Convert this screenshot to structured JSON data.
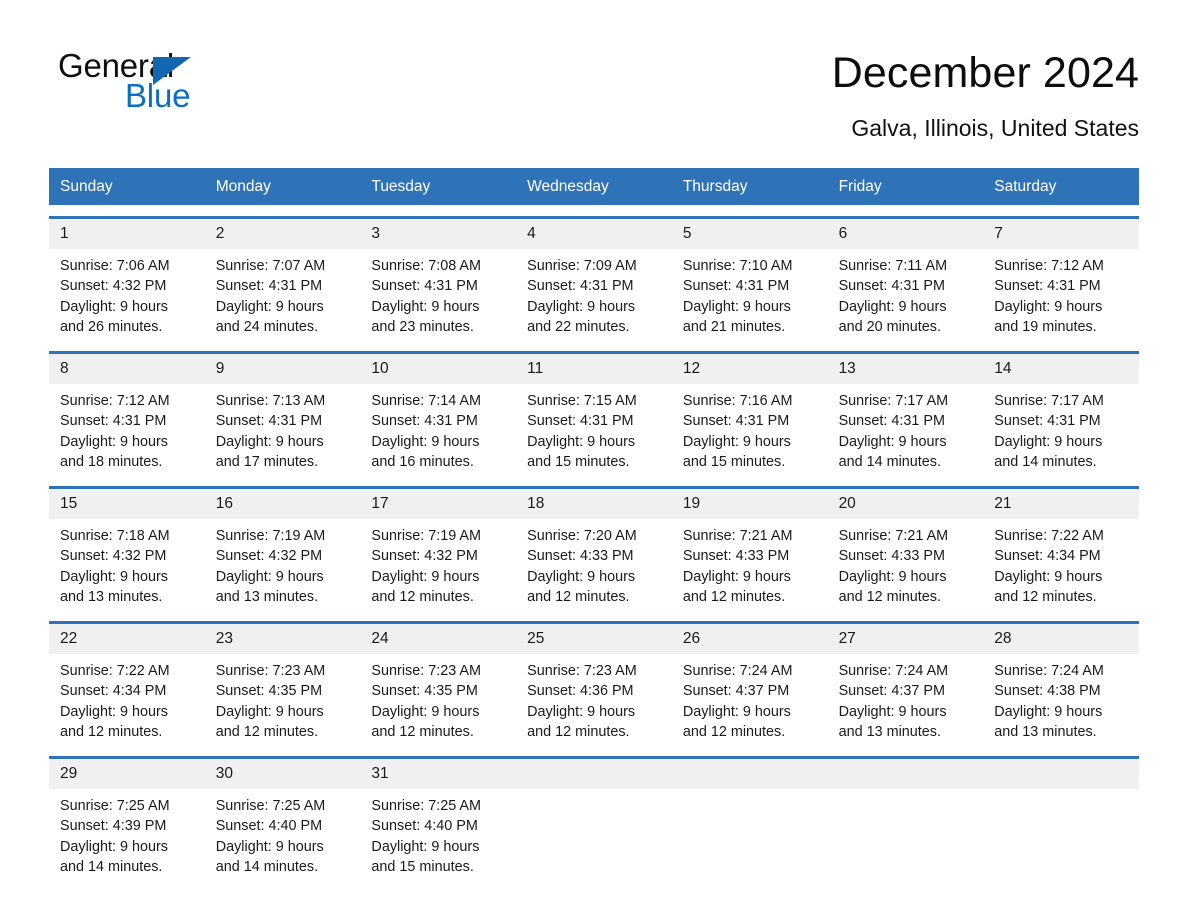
{
  "brand": {
    "word1": "General",
    "word2": "Blue",
    "triangle_color": "#1267b0",
    "blue_color": "#0a6fc2"
  },
  "header": {
    "title": "December 2024",
    "location": "Galva, Illinois, United States"
  },
  "theme": {
    "header_blue": "#2e73b8",
    "date_band": "#f0f0f0",
    "text": "#1a1a1a"
  },
  "weekdays": [
    "Sunday",
    "Monday",
    "Tuesday",
    "Wednesday",
    "Thursday",
    "Friday",
    "Saturday"
  ],
  "weeks": [
    [
      {
        "date": "1",
        "sunrise": "Sunrise: 7:06 AM",
        "sunset": "Sunset: 4:32 PM",
        "daylight1": "Daylight: 9 hours",
        "daylight2": "and 26 minutes."
      },
      {
        "date": "2",
        "sunrise": "Sunrise: 7:07 AM",
        "sunset": "Sunset: 4:31 PM",
        "daylight1": "Daylight: 9 hours",
        "daylight2": "and 24 minutes."
      },
      {
        "date": "3",
        "sunrise": "Sunrise: 7:08 AM",
        "sunset": "Sunset: 4:31 PM",
        "daylight1": "Daylight: 9 hours",
        "daylight2": "and 23 minutes."
      },
      {
        "date": "4",
        "sunrise": "Sunrise: 7:09 AM",
        "sunset": "Sunset: 4:31 PM",
        "daylight1": "Daylight: 9 hours",
        "daylight2": "and 22 minutes."
      },
      {
        "date": "5",
        "sunrise": "Sunrise: 7:10 AM",
        "sunset": "Sunset: 4:31 PM",
        "daylight1": "Daylight: 9 hours",
        "daylight2": "and 21 minutes."
      },
      {
        "date": "6",
        "sunrise": "Sunrise: 7:11 AM",
        "sunset": "Sunset: 4:31 PM",
        "daylight1": "Daylight: 9 hours",
        "daylight2": "and 20 minutes."
      },
      {
        "date": "7",
        "sunrise": "Sunrise: 7:12 AM",
        "sunset": "Sunset: 4:31 PM",
        "daylight1": "Daylight: 9 hours",
        "daylight2": "and 19 minutes."
      }
    ],
    [
      {
        "date": "8",
        "sunrise": "Sunrise: 7:12 AM",
        "sunset": "Sunset: 4:31 PM",
        "daylight1": "Daylight: 9 hours",
        "daylight2": "and 18 minutes."
      },
      {
        "date": "9",
        "sunrise": "Sunrise: 7:13 AM",
        "sunset": "Sunset: 4:31 PM",
        "daylight1": "Daylight: 9 hours",
        "daylight2": "and 17 minutes."
      },
      {
        "date": "10",
        "sunrise": "Sunrise: 7:14 AM",
        "sunset": "Sunset: 4:31 PM",
        "daylight1": "Daylight: 9 hours",
        "daylight2": "and 16 minutes."
      },
      {
        "date": "11",
        "sunrise": "Sunrise: 7:15 AM",
        "sunset": "Sunset: 4:31 PM",
        "daylight1": "Daylight: 9 hours",
        "daylight2": "and 15 minutes."
      },
      {
        "date": "12",
        "sunrise": "Sunrise: 7:16 AM",
        "sunset": "Sunset: 4:31 PM",
        "daylight1": "Daylight: 9 hours",
        "daylight2": "and 15 minutes."
      },
      {
        "date": "13",
        "sunrise": "Sunrise: 7:17 AM",
        "sunset": "Sunset: 4:31 PM",
        "daylight1": "Daylight: 9 hours",
        "daylight2": "and 14 minutes."
      },
      {
        "date": "14",
        "sunrise": "Sunrise: 7:17 AM",
        "sunset": "Sunset: 4:31 PM",
        "daylight1": "Daylight: 9 hours",
        "daylight2": "and 14 minutes."
      }
    ],
    [
      {
        "date": "15",
        "sunrise": "Sunrise: 7:18 AM",
        "sunset": "Sunset: 4:32 PM",
        "daylight1": "Daylight: 9 hours",
        "daylight2": "and 13 minutes."
      },
      {
        "date": "16",
        "sunrise": "Sunrise: 7:19 AM",
        "sunset": "Sunset: 4:32 PM",
        "daylight1": "Daylight: 9 hours",
        "daylight2": "and 13 minutes."
      },
      {
        "date": "17",
        "sunrise": "Sunrise: 7:19 AM",
        "sunset": "Sunset: 4:32 PM",
        "daylight1": "Daylight: 9 hours",
        "daylight2": "and 12 minutes."
      },
      {
        "date": "18",
        "sunrise": "Sunrise: 7:20 AM",
        "sunset": "Sunset: 4:33 PM",
        "daylight1": "Daylight: 9 hours",
        "daylight2": "and 12 minutes."
      },
      {
        "date": "19",
        "sunrise": "Sunrise: 7:21 AM",
        "sunset": "Sunset: 4:33 PM",
        "daylight1": "Daylight: 9 hours",
        "daylight2": "and 12 minutes."
      },
      {
        "date": "20",
        "sunrise": "Sunrise: 7:21 AM",
        "sunset": "Sunset: 4:33 PM",
        "daylight1": "Daylight: 9 hours",
        "daylight2": "and 12 minutes."
      },
      {
        "date": "21",
        "sunrise": "Sunrise: 7:22 AM",
        "sunset": "Sunset: 4:34 PM",
        "daylight1": "Daylight: 9 hours",
        "daylight2": "and 12 minutes."
      }
    ],
    [
      {
        "date": "22",
        "sunrise": "Sunrise: 7:22 AM",
        "sunset": "Sunset: 4:34 PM",
        "daylight1": "Daylight: 9 hours",
        "daylight2": "and 12 minutes."
      },
      {
        "date": "23",
        "sunrise": "Sunrise: 7:23 AM",
        "sunset": "Sunset: 4:35 PM",
        "daylight1": "Daylight: 9 hours",
        "daylight2": "and 12 minutes."
      },
      {
        "date": "24",
        "sunrise": "Sunrise: 7:23 AM",
        "sunset": "Sunset: 4:35 PM",
        "daylight1": "Daylight: 9 hours",
        "daylight2": "and 12 minutes."
      },
      {
        "date": "25",
        "sunrise": "Sunrise: 7:23 AM",
        "sunset": "Sunset: 4:36 PM",
        "daylight1": "Daylight: 9 hours",
        "daylight2": "and 12 minutes."
      },
      {
        "date": "26",
        "sunrise": "Sunrise: 7:24 AM",
        "sunset": "Sunset: 4:37 PM",
        "daylight1": "Daylight: 9 hours",
        "daylight2": "and 12 minutes."
      },
      {
        "date": "27",
        "sunrise": "Sunrise: 7:24 AM",
        "sunset": "Sunset: 4:37 PM",
        "daylight1": "Daylight: 9 hours",
        "daylight2": "and 13 minutes."
      },
      {
        "date": "28",
        "sunrise": "Sunrise: 7:24 AM",
        "sunset": "Sunset: 4:38 PM",
        "daylight1": "Daylight: 9 hours",
        "daylight2": "and 13 minutes."
      }
    ],
    [
      {
        "date": "29",
        "sunrise": "Sunrise: 7:25 AM",
        "sunset": "Sunset: 4:39 PM",
        "daylight1": "Daylight: 9 hours",
        "daylight2": "and 14 minutes."
      },
      {
        "date": "30",
        "sunrise": "Sunrise: 7:25 AM",
        "sunset": "Sunset: 4:40 PM",
        "daylight1": "Daylight: 9 hours",
        "daylight2": "and 14 minutes."
      },
      {
        "date": "31",
        "sunrise": "Sunrise: 7:25 AM",
        "sunset": "Sunset: 4:40 PM",
        "daylight1": "Daylight: 9 hours",
        "daylight2": "and 15 minutes."
      },
      {
        "date": "",
        "sunrise": "",
        "sunset": "",
        "daylight1": "",
        "daylight2": ""
      },
      {
        "date": "",
        "sunrise": "",
        "sunset": "",
        "daylight1": "",
        "daylight2": ""
      },
      {
        "date": "",
        "sunrise": "",
        "sunset": "",
        "daylight1": "",
        "daylight2": ""
      },
      {
        "date": "",
        "sunrise": "",
        "sunset": "",
        "daylight1": "",
        "daylight2": ""
      }
    ]
  ]
}
